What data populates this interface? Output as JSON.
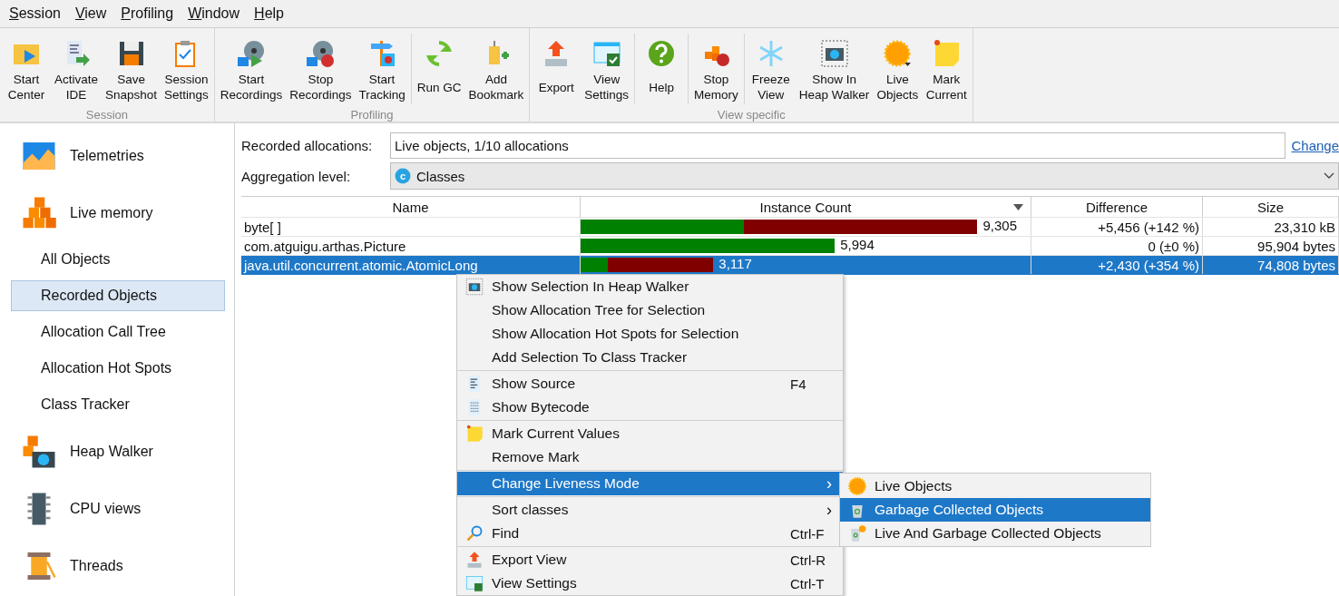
{
  "menu_bar": [
    {
      "label": "Session"
    },
    {
      "label": "View"
    },
    {
      "label": "Profiling"
    },
    {
      "label": "Window"
    },
    {
      "label": "Help"
    }
  ],
  "toolbar": {
    "groups": [
      {
        "label": "Session",
        "sections": [
          [
            {
              "label": "Start\nCenter"
            },
            {
              "label": "Activate\nIDE"
            },
            {
              "label": "Save\nSnapshot"
            },
            {
              "label": "Session\nSettings"
            }
          ]
        ]
      },
      {
        "label": "Profiling",
        "sections": [
          [
            {
              "label": "Start\nRecordings"
            },
            {
              "label": "Stop\nRecordings"
            },
            {
              "label": "Start\nTracking"
            }
          ],
          [
            {
              "label": "Run GC"
            },
            {
              "label": "Add\nBookmark"
            }
          ]
        ]
      },
      {
        "label": "View specific",
        "sections": [
          [
            {
              "label": "Export"
            },
            {
              "label": "View\nSettings"
            }
          ],
          [
            {
              "label": "Help"
            }
          ],
          [
            {
              "label": "Stop\nMemory"
            }
          ],
          [
            {
              "label": "Freeze\nView"
            },
            {
              "label": "Show In\nHeap Walker"
            },
            {
              "label": "Live\nObjects"
            },
            {
              "label": "Mark\nCurrent"
            }
          ]
        ]
      }
    ]
  },
  "sidebar": {
    "items": [
      {
        "label": "Telemetries",
        "selected": false
      },
      {
        "label": "Live memory",
        "selected": false,
        "children": [
          {
            "label": "All Objects",
            "selected": false
          },
          {
            "label": "Recorded Objects",
            "selected": true
          },
          {
            "label": "Allocation Call Tree",
            "selected": false
          },
          {
            "label": "Allocation Hot Spots",
            "selected": false
          },
          {
            "label": "Class Tracker",
            "selected": false
          }
        ]
      },
      {
        "label": "Heap Walker",
        "selected": false
      },
      {
        "label": "CPU views",
        "selected": false
      },
      {
        "label": "Threads",
        "selected": false
      }
    ]
  },
  "recorded_allocations": {
    "label": "Recorded allocations:",
    "value": "Live objects, 1/10 allocations",
    "link": "Change"
  },
  "aggregation": {
    "label": "Aggregation level:",
    "value": "Classes",
    "icon_letter": "c"
  },
  "table": {
    "columns": [
      {
        "label": "Name",
        "sorted": false
      },
      {
        "label": "Instance Count",
        "sorted": true
      },
      {
        "label": "Difference",
        "sorted": false
      },
      {
        "label": "Size",
        "sorted": false
      }
    ],
    "rows": [
      {
        "name": "byte[ ]",
        "bar": [
          {
            "color": "#008000",
            "level": 0.362
          },
          {
            "color": "#800000",
            "level": 0.882
          }
        ],
        "count": "9,305",
        "difference": "+5,456 (+142 %)",
        "size": "23,310 kB",
        "selected": false
      },
      {
        "name": "com.atguigu.arthas.Picture",
        "bar": [
          {
            "color": "#008000",
            "level": 0.565
          }
        ],
        "count": "5,994",
        "difference": "0 (±0 %)",
        "size": "95,904 bytes",
        "selected": false
      },
      {
        "name": "java.util.concurrent.atomic.AtomicLong",
        "bar": [
          {
            "color": "#008000",
            "level": 0.06
          },
          {
            "color": "#800000",
            "level": 0.295
          }
        ],
        "count": "3,117",
        "difference": "+2,430 (+354 %)",
        "size": "74,808 bytes",
        "selected": true
      }
    ]
  },
  "context_menu": {
    "groups": [
      [
        {
          "label": "Show Selection In Heap Walker",
          "selected": false
        },
        {
          "label": "Show Allocation Tree for Selection",
          "selected": false
        },
        {
          "label": "Show Allocation Hot Spots for Selection",
          "selected": false
        },
        {
          "label": "Add Selection To Class Tracker",
          "selected": false
        }
      ],
      [
        {
          "label": "Show Source",
          "shortcut": "F4",
          "selected": false
        },
        {
          "label": "Show Bytecode",
          "selected": false
        }
      ],
      [
        {
          "label": "Mark Current Values",
          "selected": false
        },
        {
          "label": "Remove Mark",
          "selected": false
        }
      ],
      [
        {
          "label": "Change Liveness Mode",
          "arrow": "›",
          "selected": true
        }
      ],
      [
        {
          "label": "Sort classes",
          "arrow": "›",
          "selected": false
        },
        {
          "label": "Find",
          "shortcut": "Ctrl-F",
          "selected": false
        }
      ],
      [
        {
          "label": "Export View",
          "shortcut": "Ctrl-R",
          "selected": false
        },
        {
          "label": "View Settings",
          "shortcut": "Ctrl-T",
          "selected": false
        }
      ]
    ]
  },
  "submenu": {
    "items": [
      {
        "label": "Live Objects",
        "selected": false
      },
      {
        "label": "Garbage Collected Objects",
        "selected": true
      },
      {
        "label": "Live And Garbage Collected Objects",
        "selected": false
      }
    ]
  }
}
